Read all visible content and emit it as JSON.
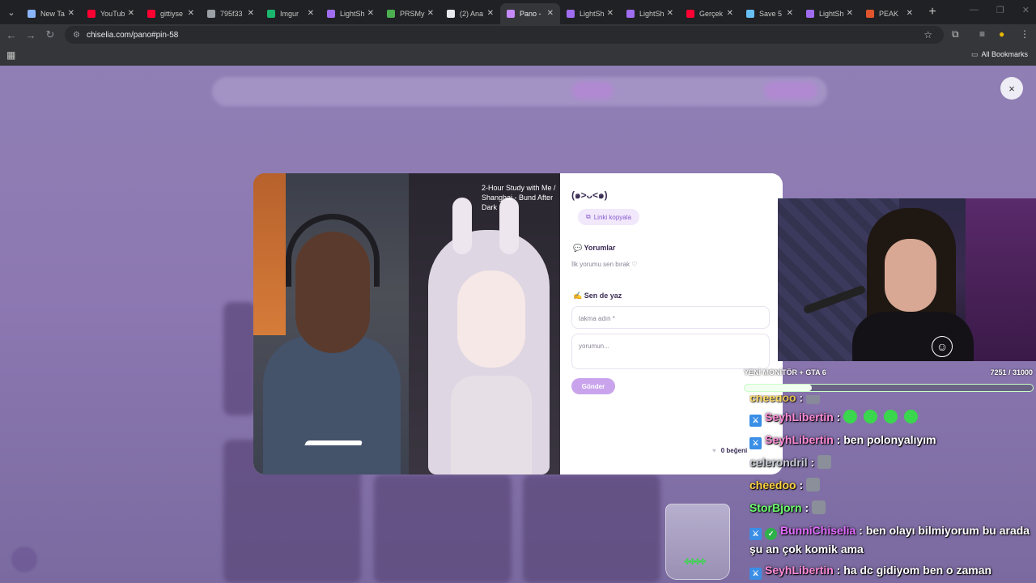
{
  "browser": {
    "tabs": [
      {
        "label": "New Ta",
        "color": "#8ab4f8"
      },
      {
        "label": "YouTub",
        "color": "#ff0033"
      },
      {
        "label": "gittiyse",
        "color": "#ff0033"
      },
      {
        "label": "795f33",
        "color": "#9aa0a6"
      },
      {
        "label": "Imgur",
        "color": "#1bb76e"
      },
      {
        "label": "LightSh",
        "color": "#a06cf0"
      },
      {
        "label": "PRSMy",
        "color": "#4caf50"
      },
      {
        "label": "(2) Ana",
        "color": "#e8eaed"
      },
      {
        "label": "Pano -",
        "color": "#c58af9"
      },
      {
        "label": "LightSh",
        "color": "#a06cf0"
      },
      {
        "label": "LightSh",
        "color": "#a06cf0"
      },
      {
        "label": "Gerçek",
        "color": "#ff0033"
      },
      {
        "label": "Save 5",
        "color": "#66c0f4"
      },
      {
        "label": "LightSh",
        "color": "#a06cf0"
      },
      {
        "label": "PEAK",
        "color": "#e0552b"
      }
    ],
    "active_tab_index": 8,
    "new_tab_label": "+",
    "url": "chiselia.com/pano#pin-58",
    "bookmarks_label": "All Bookmarks"
  },
  "modal": {
    "title": "(๑>ᴗ<๑)",
    "copy_link_label": "Linki kopyala",
    "comments_header": "💬 Yorumlar",
    "comments_empty": "İlk yorumu sen bırak ♡",
    "write_header": "✍️ Sen de yaz",
    "nickname_placeholder": "takma adın *",
    "comment_placeholder": "yorumun...",
    "send_label": "Gönder",
    "likes_label": "0 beğeni",
    "close_label": "×",
    "image_title": "2-Hour Study with Me / Shanghai - Bund After Dark"
  },
  "stream": {
    "goal_label": "YENİ MONİTÖR + GTA 6",
    "goal_count": "7251 / 31000",
    "goal_fraction": 0.234,
    "chat": [
      {
        "badge": true,
        "user": "SeyhLibertin",
        "emotes": 4,
        "text": ""
      },
      {
        "badge": true,
        "user": "SeyhLibertin",
        "emotes": 0,
        "text": "ben polonyalıyım"
      },
      {
        "badge": false,
        "user": "celerondril",
        "emotes": 1,
        "text": ""
      },
      {
        "badge": false,
        "user": "cheedoo",
        "emotes": 1,
        "text": ""
      },
      {
        "badge": false,
        "user": "StorBjorn",
        "emotes": 1,
        "text": ""
      },
      {
        "badge": true,
        "mod": true,
        "user": "BunniChiselia",
        "emotes": 0,
        "text": "ben olayı bilmiyorum bu arada şu an çok komik ama"
      },
      {
        "badge": true,
        "user": "SeyhLibertin",
        "emotes": 0,
        "text": "ha dc gidiyom ben o zaman"
      }
    ]
  }
}
